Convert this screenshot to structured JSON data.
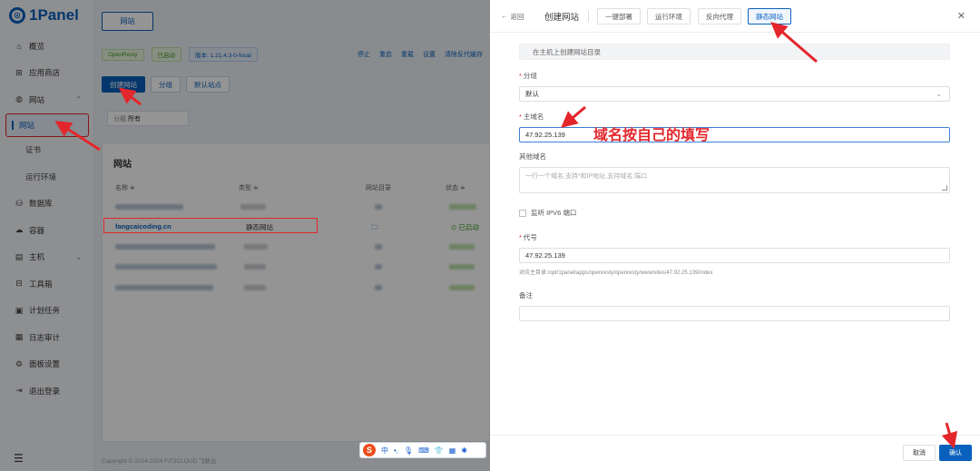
{
  "logo": {
    "text": "1Panel"
  },
  "sidebar": {
    "items": [
      {
        "label": "概览",
        "icon": "home-icon"
      },
      {
        "label": "应用商店",
        "icon": "grid-icon"
      },
      {
        "label": "网站",
        "icon": "globe-icon"
      },
      {
        "label": "网站",
        "icon": "site-icon"
      },
      {
        "label": "证书",
        "icon": ""
      },
      {
        "label": "运行环境",
        "icon": ""
      },
      {
        "label": "数据库",
        "icon": "database-icon"
      },
      {
        "label": "容器",
        "icon": "container-icon"
      },
      {
        "label": "主机",
        "icon": "host-icon"
      },
      {
        "label": "工具箱",
        "icon": "toolbox-icon"
      },
      {
        "label": "计划任务",
        "icon": "calendar-icon"
      },
      {
        "label": "日志审计",
        "icon": "log-icon"
      },
      {
        "label": "面板设置",
        "icon": "settings-icon"
      },
      {
        "label": "退出登录",
        "icon": "logout-icon"
      }
    ]
  },
  "main": {
    "tab": "网站",
    "status": {
      "app": "OpenResty",
      "state": "已启动",
      "version": "版本: 1.21.4.3-0-focal",
      "ops": [
        "停止",
        "重启",
        "重载",
        "设置",
        "清除反代缓存"
      ]
    },
    "buttons": {
      "create": "创建网站",
      "group": "分组",
      "default": "默认站点"
    },
    "filter": {
      "label": "分组",
      "value": "所有"
    },
    "list": {
      "title": "网站",
      "headers": {
        "name": "名称 ≑",
        "type": "类型 ≑",
        "dir": "网站目录",
        "status": "状态 ≑"
      },
      "highlight_row": {
        "name": "fangcaicoding.cn",
        "type": "静态网站",
        "status": "已启动"
      }
    },
    "footer": "Copyright © 2014-2024 FIT2CLOUD 飞致云"
  },
  "ime": {
    "lang": "中",
    "punct": "•,"
  },
  "drawer": {
    "back": "返回",
    "title": "创建网站",
    "tabs": [
      "一键部署",
      "运行环境",
      "反向代理",
      "静态网站"
    ],
    "active_tab": "静态网站",
    "create_dir_note": "在主机上创建网站目录",
    "group": {
      "label": "分组",
      "value": "默认"
    },
    "domain": {
      "label": "主域名",
      "value": "47.92.25.139"
    },
    "other_domains": {
      "label": "其他域名",
      "placeholder": "一行一个域名,支持*和IP地址,支持域名:端口"
    },
    "ipv6": {
      "label": "监听 IPV6 端口"
    },
    "alias": {
      "label": "代号",
      "value": "47.92.25.139",
      "hint": "对应主目录:/opt/1panel/apps/openresty/openresty/www/sites/47.92.25.139/index"
    },
    "remark": {
      "label": "备注",
      "value": ""
    },
    "cancel": "取消",
    "confirm": "确认"
  },
  "annotation": {
    "text": "域名按自己的填写"
  },
  "colors": {
    "accent": "#0960bd",
    "annotation": "#e3262b"
  }
}
